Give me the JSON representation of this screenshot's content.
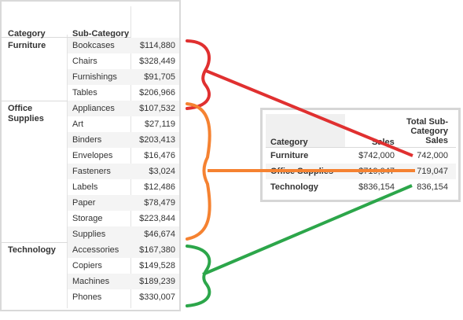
{
  "left_table": {
    "headers": {
      "category": "Category",
      "subcategory": "Sub-Category"
    },
    "groups": [
      {
        "category": "Furniture",
        "rows": [
          {
            "sub": "Bookcases",
            "sales": "$114,880"
          },
          {
            "sub": "Chairs",
            "sales": "$328,449"
          },
          {
            "sub": "Furnishings",
            "sales": "$91,705"
          },
          {
            "sub": "Tables",
            "sales": "$206,966"
          }
        ]
      },
      {
        "category": "Office\nSupplies",
        "rows": [
          {
            "sub": "Appliances",
            "sales": "$107,532"
          },
          {
            "sub": "Art",
            "sales": "$27,119"
          },
          {
            "sub": "Binders",
            "sales": "$203,413"
          },
          {
            "sub": "Envelopes",
            "sales": "$16,476"
          },
          {
            "sub": "Fasteners",
            "sales": "$3,024"
          },
          {
            "sub": "Labels",
            "sales": "$12,486"
          },
          {
            "sub": "Paper",
            "sales": "$78,479"
          },
          {
            "sub": "Storage",
            "sales": "$223,844"
          },
          {
            "sub": "Supplies",
            "sales": "$46,674"
          }
        ]
      },
      {
        "category": "Technology",
        "rows": [
          {
            "sub": "Accessories",
            "sales": "$167,380"
          },
          {
            "sub": "Copiers",
            "sales": "$149,528"
          },
          {
            "sub": "Machines",
            "sales": "$189,239"
          },
          {
            "sub": "Phones",
            "sales": "$330,007"
          }
        ]
      }
    ]
  },
  "right_table": {
    "headers": {
      "category": "Category",
      "sales": "Sales",
      "total_sub": "Total Sub-\nCategory\nSales"
    },
    "rows": [
      {
        "category": "Furniture",
        "sales": "$742,000",
        "total": "742,000"
      },
      {
        "category": "Office Supplies",
        "sales": "$719,047",
        "total": "719,047"
      },
      {
        "category": "Technology",
        "sales": "$836,154",
        "total": "836,154"
      }
    ]
  },
  "annotation_colors": {
    "furniture": "#e03030",
    "office_supplies": "#f58231",
    "technology": "#2ca64a"
  }
}
